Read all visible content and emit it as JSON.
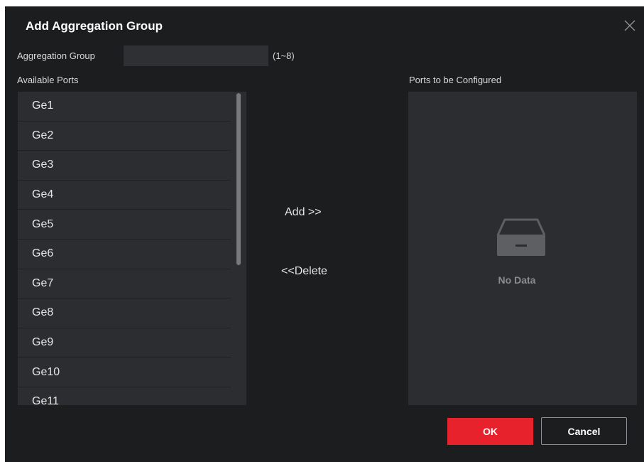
{
  "dialog": {
    "title": "Add Aggregation Group",
    "close_icon": "close-icon"
  },
  "aggregation_group": {
    "label": "Aggregation Group",
    "value": "",
    "range": "(1~8)"
  },
  "available_ports": {
    "label": "Available Ports",
    "items": [
      "Ge1",
      "Ge2",
      "Ge3",
      "Ge4",
      "Ge5",
      "Ge6",
      "Ge7",
      "Ge8",
      "Ge9",
      "Ge10",
      "Ge11"
    ]
  },
  "actions": {
    "add_label": "Add >>",
    "delete_label": "<<Delete"
  },
  "ports_to_configure": {
    "label": "Ports to be Configured",
    "empty_text": "No Data",
    "empty_icon": "empty-tray-icon"
  },
  "footer": {
    "ok_label": "OK",
    "cancel_label": "Cancel"
  },
  "colors": {
    "background": "#1c1d1f",
    "panel": "#2c2d30",
    "accent": "#e8222d"
  }
}
